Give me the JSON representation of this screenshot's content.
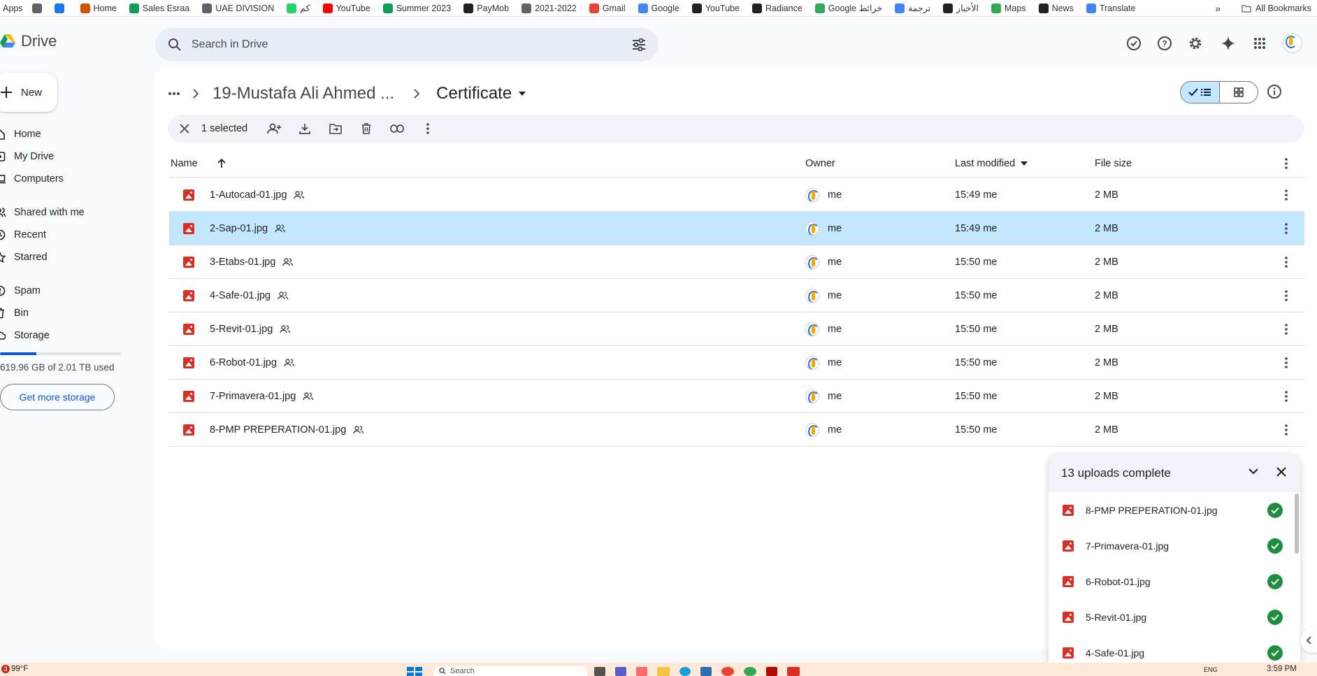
{
  "bookmarks": {
    "items": [
      {
        "label": "Apps",
        "icon": "apps-grid-icon",
        "color": "#5f6368"
      },
      {
        "label": "",
        "icon": "facebook-icon",
        "color": "#1877f2"
      },
      {
        "label": "Home",
        "icon": "home-site-icon",
        "color": "#d35400"
      },
      {
        "label": "Sales Esraa",
        "icon": "sheets-icon",
        "color": "#0f9d58"
      },
      {
        "label": "UAE DIVISION",
        "icon": "folder-icon",
        "color": "#5f6368"
      },
      {
        "label": "كم",
        "icon": "whatsapp-icon",
        "color": "#25d366"
      },
      {
        "label": "YouTube",
        "icon": "youtube-icon",
        "color": "#ff0000"
      },
      {
        "label": "Summer 2023",
        "icon": "sheets-icon",
        "color": "#0f9d58"
      },
      {
        "label": "PayMob",
        "icon": "globe-icon",
        "color": "#202124"
      },
      {
        "label": "2021-2022",
        "icon": "folder-icon",
        "color": "#5f6368"
      },
      {
        "label": "Gmail",
        "icon": "gmail-icon",
        "color": "#ea4335"
      },
      {
        "label": "Google",
        "icon": "google-icon",
        "color": "#4285f4"
      },
      {
        "label": "YouTube",
        "icon": "globe-icon",
        "color": "#202124"
      },
      {
        "label": "Radiance",
        "icon": "globe-icon",
        "color": "#202124"
      },
      {
        "label": "Google خرائط",
        "icon": "maps-icon",
        "color": "#34a853"
      },
      {
        "label": "ترجمة",
        "icon": "translate-icon",
        "color": "#4285f4"
      },
      {
        "label": "الأخبار",
        "icon": "globe-icon",
        "color": "#202124"
      },
      {
        "label": "Maps",
        "icon": "maps-icon",
        "color": "#34a853"
      },
      {
        "label": "News",
        "icon": "globe-icon",
        "color": "#202124"
      },
      {
        "label": "Translate",
        "icon": "translate-icon",
        "color": "#4285f4"
      }
    ],
    "overflow": "»",
    "all_bookmarks": "All Bookmarks"
  },
  "header": {
    "app_name": "Drive",
    "search_placeholder": "Search in Drive"
  },
  "sidebar": {
    "new_label": "New",
    "items": [
      {
        "label": "Home",
        "icon": "home-icon"
      },
      {
        "label": "My Drive",
        "icon": "my-drive-icon"
      },
      {
        "label": "Computers",
        "icon": "computer-icon"
      },
      {
        "label": "Shared with me",
        "icon": "shared-people-icon"
      },
      {
        "label": "Recent",
        "icon": "clock-icon"
      },
      {
        "label": "Starred",
        "icon": "star-icon"
      },
      {
        "label": "Spam",
        "icon": "spam-icon"
      },
      {
        "label": "Bin",
        "icon": "trash-icon"
      },
      {
        "label": "Storage",
        "icon": "cloud-icon"
      }
    ],
    "storage_used_fraction": 0.3,
    "storage_text": "619.96 GB of 2.01 TB used",
    "get_storage_label": "Get more storage"
  },
  "breadcrumb": {
    "parent": "19-Mustafa Ali Ahmed ...",
    "current": "Certificate"
  },
  "actionbar": {
    "selected_text": "1 selected"
  },
  "table": {
    "headers": {
      "name": "Name",
      "owner": "Owner",
      "modified": "Last modified",
      "size": "File size"
    },
    "rows": [
      {
        "name": "1-Autocad-01.jpg",
        "owner": "me",
        "modified": "15:49 me",
        "size": "2 MB",
        "selected": false
      },
      {
        "name": "2-Sap-01.jpg",
        "owner": "me",
        "modified": "15:49 me",
        "size": "2 MB",
        "selected": true
      },
      {
        "name": "3-Etabs-01.jpg",
        "owner": "me",
        "modified": "15:50 me",
        "size": "2 MB",
        "selected": false
      },
      {
        "name": "4-Safe-01.jpg",
        "owner": "me",
        "modified": "15:50 me",
        "size": "2 MB",
        "selected": false
      },
      {
        "name": "5-Revit-01.jpg",
        "owner": "me",
        "modified": "15:50 me",
        "size": "2 MB",
        "selected": false
      },
      {
        "name": "6-Robot-01.jpg",
        "owner": "me",
        "modified": "15:50 me",
        "size": "2 MB",
        "selected": false
      },
      {
        "name": "7-Primavera-01.jpg",
        "owner": "me",
        "modified": "15:50 me",
        "size": "2 MB",
        "selected": false
      },
      {
        "name": "8-PMP PREPERATION-01.jpg",
        "owner": "me",
        "modified": "15:50 me",
        "size": "2 MB",
        "selected": false
      }
    ]
  },
  "uploads": {
    "title": "13 uploads complete",
    "items": [
      "8-PMP PREPERATION-01.jpg",
      "7-Primavera-01.jpg",
      "6-Robot-01.jpg",
      "5-Revit-01.jpg",
      "4-Safe-01.jpg"
    ]
  },
  "taskbar": {
    "badge": "3",
    "weather": "99°F",
    "search": "Search",
    "lang": "ENG",
    "time": "3:59 PM"
  },
  "colors": {
    "accent": "#0b57d0",
    "selected_row": "#c2e7ff",
    "image_icon": "#d93025",
    "success": "#1e8e3e"
  }
}
